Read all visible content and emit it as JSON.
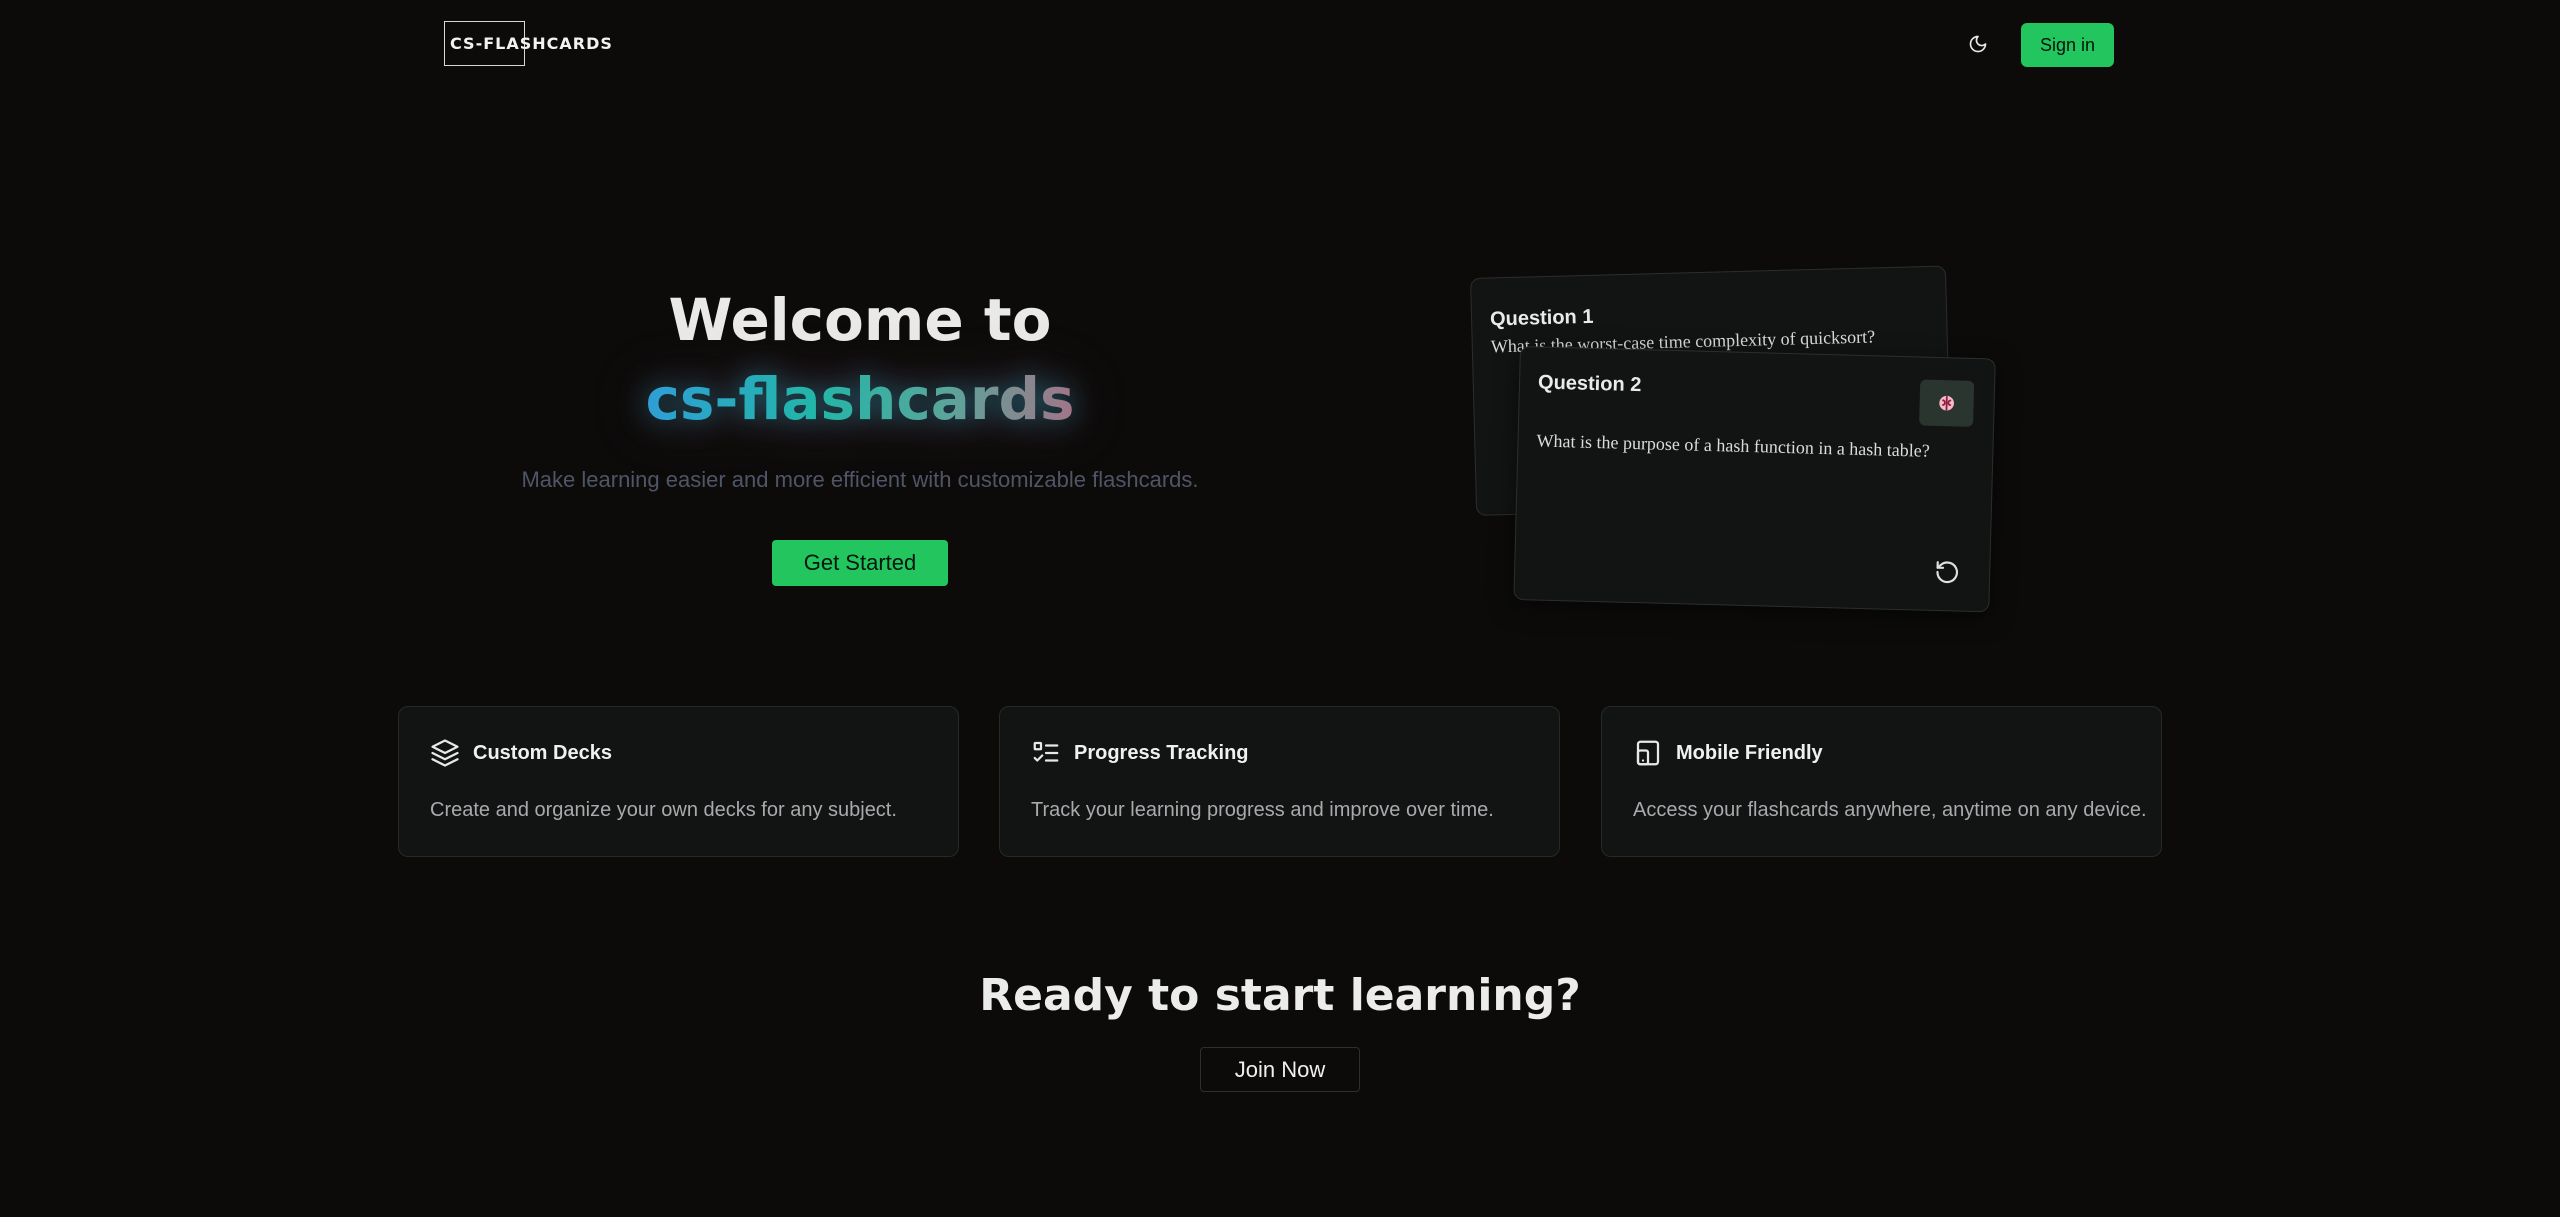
{
  "header": {
    "logo_text": "CS-FLASHCARDS",
    "theme_toggle_icon": "moon-icon",
    "signin_label": "Sign in"
  },
  "hero": {
    "title_line1": "Welcome to",
    "title_brand": "cs-flashcards",
    "subtitle": "Make learning easier and more efficient with customizable flashcards.",
    "cta_label": "Get Started"
  },
  "cards": {
    "back": {
      "title": "Question 1",
      "question": "What is the worst-case time complexity of quicksort?"
    },
    "front": {
      "title": "Question 2",
      "question": "What is the purpose of a hash function in a hash table?",
      "brain_icon": "brain-icon",
      "flip_icon": "rotate-ccw-icon"
    }
  },
  "features": [
    {
      "icon": "layers-icon",
      "title": "Custom Decks",
      "description": "Create and organize your own decks for any subject."
    },
    {
      "icon": "list-checks-icon",
      "title": "Progress Tracking",
      "description": "Track your learning progress and improve over time."
    },
    {
      "icon": "tablet-smartphone-icon",
      "title": "Mobile Friendly",
      "description": "Access your flashcards anywhere, anytime on any device."
    }
  ],
  "cta": {
    "title": "Ready to start learning?",
    "button_label": "Join Now"
  },
  "colors": {
    "background": "#0c0b0a",
    "accent": "#22c55e",
    "card": "#111412"
  }
}
